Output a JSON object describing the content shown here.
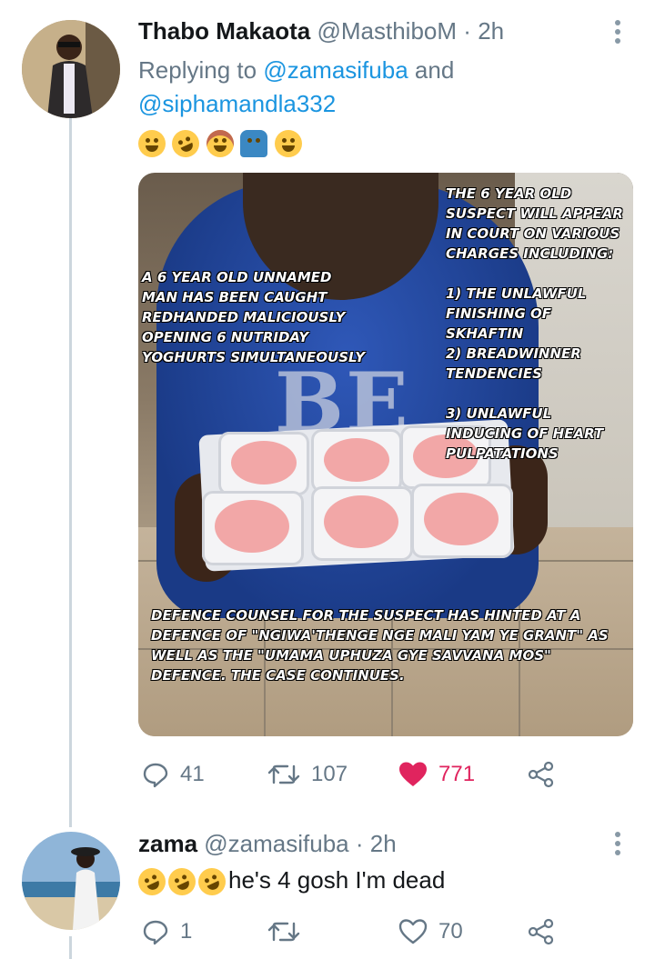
{
  "tweet1": {
    "name": "Thabo Makaota",
    "handle": "@MasthiboM",
    "dot": "·",
    "time": "2h",
    "replying_prefix": "Replying to ",
    "mention1": "@zamasifuba",
    "and_text": " and",
    "mention2": "@siphamandla332",
    "emoji_icons": [
      "face-with-tears-of-joy-icon",
      "rolling-on-floor-laughing-icon",
      "person-facepalming-icon",
      "person-shrugging-icon",
      "grinning-sweat-icon"
    ],
    "image": {
      "caption_top_right": "THE 6 YEAR OLD SUSPECT WILL APPEAR IN COURT ON VARIOUS CHARGES INCLUDING:",
      "caption_left": "A 6 YEAR OLD UNNAMED MAN HAS BEEN CAUGHT REDHANDED MALICIOUSLY OPENING 6 NUTRIDAY YOGHURTS SIMULTANEOUSLY",
      "charge1": "1) THE UNLAWFUL FINISHING OF SKHAFTIN",
      "charge2": "2) BREADWINNER TENDENCIES",
      "charge3": "3) UNLAWFUL INDUCING OF HEART PULPATATIONS",
      "caption_bottom": "DEFENCE COUNSEL FOR THE SUSPECT HAS HINTED AT A DEFENCE OF \"NGIWA'THENGE NGE MALI YAM YE GRANT\" AS WELL AS THE \"UMAMA UPHUZA GYE SAVVANA MOS\" DEFENCE. THE CASE CONTINUES.",
      "hoodie_text": "BE"
    },
    "replies": "41",
    "retweets": "107",
    "likes": "771",
    "like_color": "#e0245e"
  },
  "tweet2": {
    "name": "zama",
    "handle": "@zamasifuba",
    "dot": "·",
    "time": "2h",
    "emoji_icons": [
      "rolling-on-floor-laughing-icon",
      "rolling-on-floor-laughing-icon",
      "rolling-on-floor-laughing-icon"
    ],
    "text": "he's 4 gosh I'm dead",
    "replies": "1",
    "retweets": "",
    "likes": "70"
  },
  "colors": {
    "accent": "#1b95e0",
    "secondary_text": "#657786",
    "thread_line": "#ccd6dd"
  }
}
